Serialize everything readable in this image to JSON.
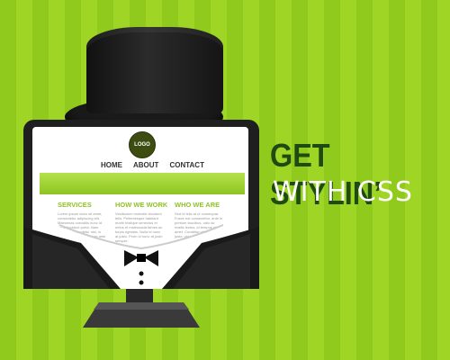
{
  "screen": {
    "logo": "LOGO",
    "nav": [
      "HOME",
      "ABOUT",
      "CONTACT"
    ],
    "columns": [
      {
        "title": "SERVICES",
        "text": "Lorem ipsum dolor sit amet, consectetur adipiscing elit. Maecenas convallis nunc id risus tincidunt porta. Nam sodales consectetur nisi, in pellentesque. Vestibulum ante ipsum primis in faucibus orci luctus."
      },
      {
        "title": "HOW WE WORK",
        "text": "Vestibulum molestie tincidunt felis. Pellentesque habitant morbi tristique senectus et netus et malesuada fames ac turpis egestas. Nulla id nunc at justo. Proin id nunc at justo semper."
      },
      {
        "title": "WHO WE ARE",
        "text": "Sed id felis at ut consequat. Fusce est consectetur, ante in pretium faucibus, odio ac mattis lectus, id tempus sit amet. Curabitur vitae ornare justo, vel mattis sem. Aenean a nisl ante."
      }
    ]
  },
  "headline": {
    "line1": "GET STYLIN’",
    "line2": "WITH CSS"
  },
  "colors": {
    "stripe_light": "#9fd626",
    "stripe_dark": "#8fca1c",
    "accent_green": "#8cc521",
    "headline_dark": "#1f4a12"
  }
}
